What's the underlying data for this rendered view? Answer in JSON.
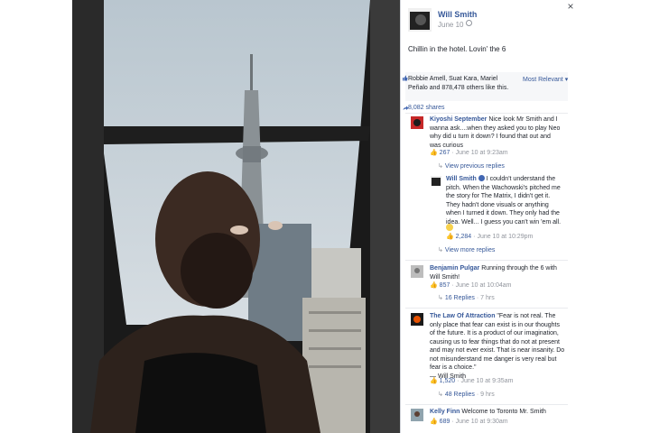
{
  "post": {
    "author": "Will Smith",
    "date": "June 10",
    "text": "Chillin in the hotel. Lovin' the 6"
  },
  "close_icon": "×",
  "likes": {
    "text": "Robbie Amell, Suat Kara, Mariel Peñalo and 878,478 others like this.",
    "sort_label": "Most Relevant",
    "shares": "8,082 shares"
  },
  "comments": [
    {
      "name": "Kiyoshi September",
      "text": "Nice look Mr Smith and I wanna ask....when they asked you to play Neo why did u turn it down? I found that out and was curious",
      "count": "267",
      "time": "June 10 at 9:23am",
      "view_previous": "View previous replies",
      "reply": {
        "name": "Will Smith",
        "text": "I couldn't understand the pitch. When the Wachowski's pitched me the story for The Matrix, I didn't get it. They hadn't done visuals or anything when I turned it down. They only had the idea. Well... I guess you can't win 'em all.",
        "count": "2,284",
        "time": "June 10 at 10:29pm"
      },
      "view_more": "View more replies"
    },
    {
      "name": "Benjamin Pulgar",
      "text": "Running through the 6 with Will Smith!",
      "count": "857",
      "time": "June 10 at 10:04am",
      "replies": "16 Replies",
      "replies_age": "7 hrs"
    },
    {
      "name": "The Law Of Attraction",
      "text": "\"Fear is not real. The only place that fear can exist is in our thoughts of the future. It is a product of our imagination, causing us to fear things that do not at present and may not ever exist. That is near insanity. Do not misunderstand me danger is very real but fear is a choice.\"",
      "attribution": "— Will Smith",
      "count": "1,520",
      "time": "June 10 at 9:35am",
      "replies": "48 Replies",
      "replies_age": "9 hrs"
    },
    {
      "name": "Kelly Finn",
      "text": "Welcome to Toronto Mr. Smith",
      "count": "689",
      "time": "June 10 at 9:30am"
    }
  ],
  "colors": {
    "link": "#365899",
    "meta": "#90949c",
    "text": "#1d2129"
  }
}
